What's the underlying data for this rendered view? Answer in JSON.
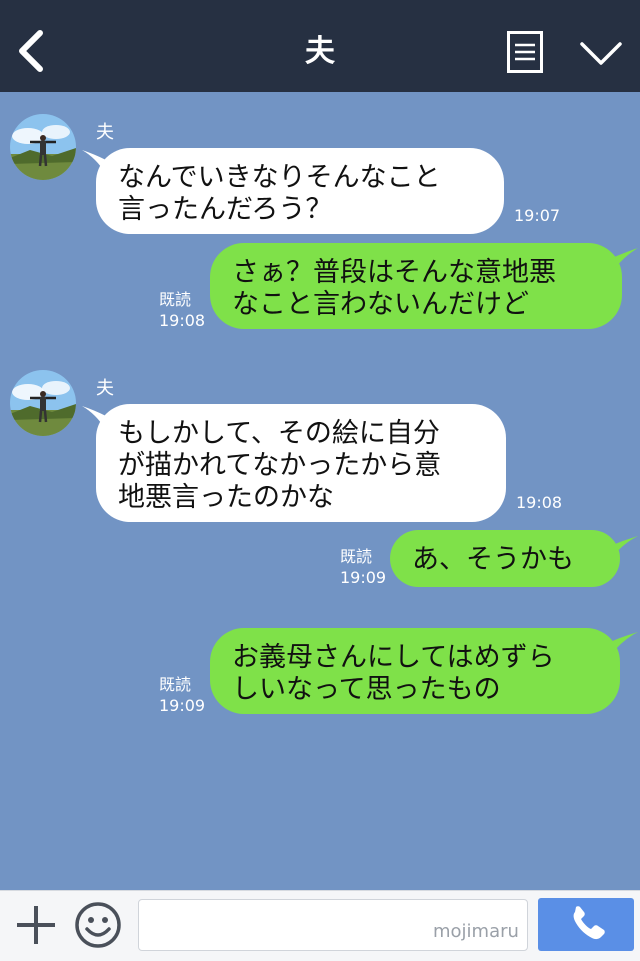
{
  "header": {
    "title": "夫"
  },
  "messages": [
    {
      "direction": "in",
      "sender": "夫",
      "text": "なんでいきなりそんなこと\n言ったんだろう？",
      "time": "19:07"
    },
    {
      "direction": "out",
      "text": "さぁ？普段はそんな意地悪\nなこと言わないんだけど",
      "read": "既読",
      "time": "19:08"
    },
    {
      "direction": "in",
      "sender": "夫",
      "text": "もしかして、その絵に自分\nが描かれてなかったから意\n地悪言ったのかな",
      "time": "19:08"
    },
    {
      "direction": "out",
      "text": "あ、そうかも",
      "read": "既読",
      "time": "19:09"
    },
    {
      "direction": "out",
      "text": "お義母さんにしてはめずら\nしいなって思ったもの",
      "read": "既読",
      "time": "19:09"
    }
  ],
  "footer": {
    "input_value": "",
    "watermark": "mojimaru"
  },
  "colors": {
    "header_bg": "#263042",
    "chat_bg": "#7294c4",
    "incoming_bubble": "#ffffff",
    "outgoing_bubble": "#7fe149",
    "call_button": "#5a8fe6"
  },
  "icons": [
    "back-arrow-icon",
    "menu-list-icon",
    "chevron-down-icon",
    "plus-icon",
    "smiley-icon",
    "phone-icon"
  ]
}
